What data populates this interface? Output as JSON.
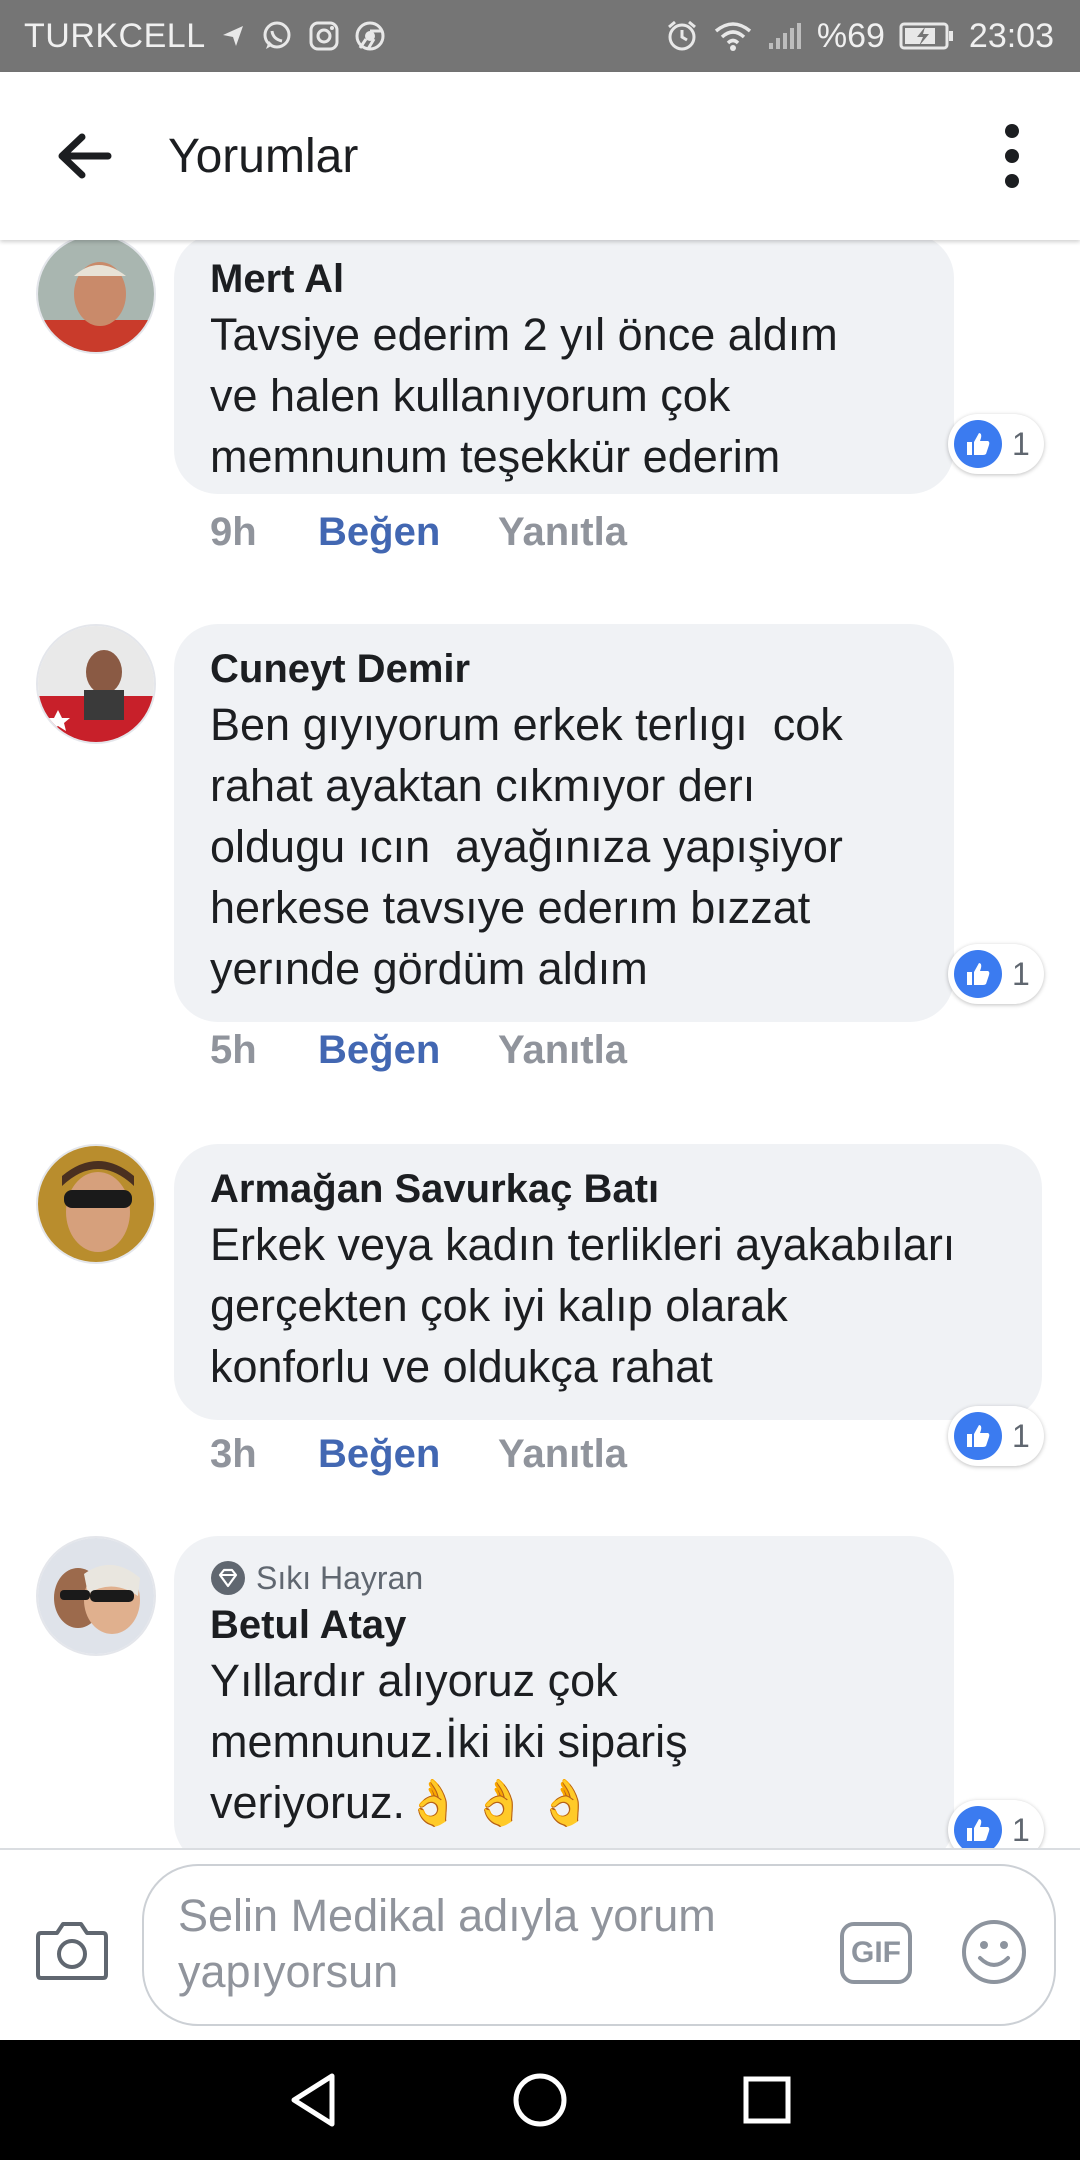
{
  "status_bar": {
    "carrier": "TURKCELL",
    "battery": "%69",
    "time": "23:03",
    "left_icons": [
      "location-arrow-icon",
      "whatsapp-icon",
      "instagram-icon",
      "chrome-icon"
    ],
    "right_icons": [
      "alarm-icon",
      "wifi-icon",
      "signal-icon",
      "battery-charging-icon"
    ]
  },
  "app_bar": {
    "title": "Yorumlar"
  },
  "comments": [
    {
      "author": "Mert Al",
      "text": "Tavsiye ederim 2 yıl önce aldım\nve halen kullanıyorum çok\nmemnunum teşekkür ederim",
      "time": "9h",
      "like_label": "Beğen",
      "reply_label": "Yanıtla",
      "reactions": "1"
    },
    {
      "author": "Cuneyt Demir",
      "text": "Ben gıyıyorum erkek terlıgı  cok\nrahat ayaktan cıkmıyor derı\noldugu ıcın  ayağınıza yapışiyor\nherkese tavsıye ederım bızzat\nyerınde gördüm aldım",
      "time": "5h",
      "like_label": "Beğen",
      "reply_label": "Yanıtla",
      "reactions": "1"
    },
    {
      "author": "Armağan Savurkaç Batı",
      "text": "Erkek veya kadın terlikleri ayakabıları\ngerçekten çok iyi kalıp olarak\nkonforlu ve oldukça rahat",
      "time": "3h",
      "like_label": "Beğen",
      "reply_label": "Yanıtla",
      "reactions": "1"
    },
    {
      "badge": "Sıkı Hayran",
      "author": "Betul Atay",
      "text": "Yıllardır alıyoruz çok\nmemnunuz.İki iki sipariş\nveriyoruz.",
      "emoji": "👌👌👌",
      "reactions": "1"
    }
  ],
  "composer": {
    "placeholder": "Selin Medikal adıyla yorum yapıyorsun",
    "gif_label": "GIF"
  },
  "colors": {
    "status_bar": "#757575",
    "like_blue": "#4267b2",
    "bubble": "#f0f2f5",
    "reaction_blue": "#3b7bf0"
  }
}
